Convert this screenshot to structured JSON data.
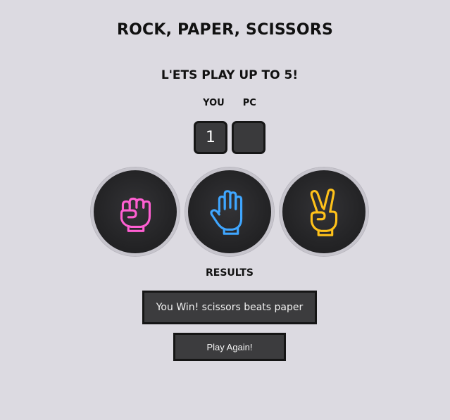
{
  "header": {
    "title": "ROCK, PAPER, SCISSORS",
    "subtitle": "L'ETS PLAY UP TO 5!"
  },
  "scoreboard": {
    "you_label": "YOU",
    "pc_label": "PC",
    "you_score": "1",
    "pc_score": ""
  },
  "choices": [
    {
      "name": "rock",
      "icon": "fist-icon",
      "color": "#ff5fd2"
    },
    {
      "name": "paper",
      "icon": "open-hand-icon",
      "color": "#3fa6ff"
    },
    {
      "name": "scissors",
      "icon": "peace-hand-icon",
      "color": "#ffc21a"
    }
  ],
  "results": {
    "label": "RESULTS",
    "message": "You Win! scissors beats paper"
  },
  "actions": {
    "play_again_label": "Play Again!"
  }
}
